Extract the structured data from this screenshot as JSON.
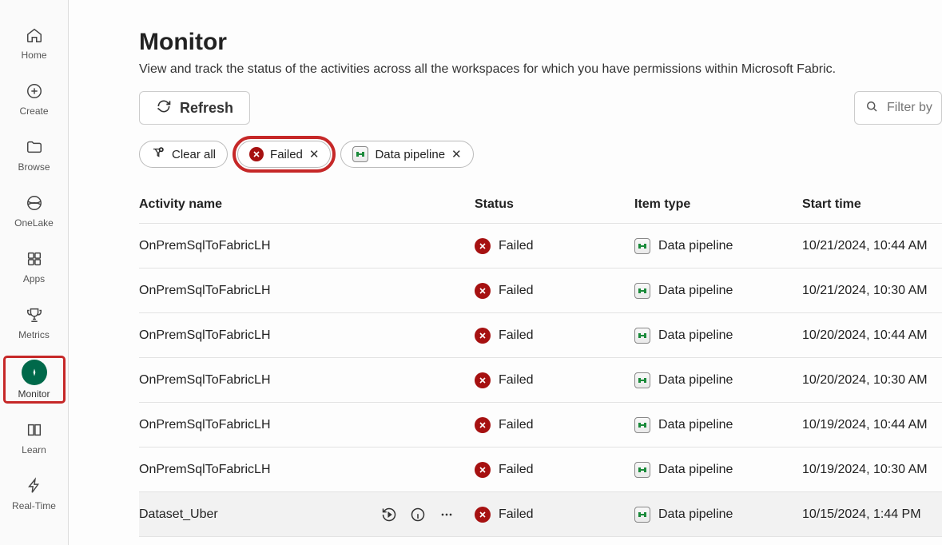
{
  "sidebar": {
    "items": [
      {
        "label": "Home"
      },
      {
        "label": "Create"
      },
      {
        "label": "Browse"
      },
      {
        "label": "OneLake"
      },
      {
        "label": "Apps"
      },
      {
        "label": "Metrics"
      },
      {
        "label": "Monitor"
      },
      {
        "label": "Learn"
      },
      {
        "label": "Real-Time"
      }
    ]
  },
  "page": {
    "title": "Monitor",
    "subtitle": "View and track the status of the activities across all the workspaces for which you have permissions within Microsoft Fabric."
  },
  "toolbar": {
    "refresh": "Refresh",
    "filter_placeholder": "Filter by"
  },
  "chips": {
    "clear_all": "Clear all",
    "failed": "Failed",
    "data_pipeline": "Data pipeline"
  },
  "table": {
    "headers": {
      "activity": "Activity name",
      "status": "Status",
      "type": "Item type",
      "start": "Start time"
    },
    "rows": [
      {
        "name": "OnPremSqlToFabricLH",
        "status": "Failed",
        "type": "Data pipeline",
        "start": "10/21/2024, 10:44 AM",
        "hover": false
      },
      {
        "name": "OnPremSqlToFabricLH",
        "status": "Failed",
        "type": "Data pipeline",
        "start": "10/21/2024, 10:30 AM",
        "hover": false
      },
      {
        "name": "OnPremSqlToFabricLH",
        "status": "Failed",
        "type": "Data pipeline",
        "start": "10/20/2024, 10:44 AM",
        "hover": false
      },
      {
        "name": "OnPremSqlToFabricLH",
        "status": "Failed",
        "type": "Data pipeline",
        "start": "10/20/2024, 10:30 AM",
        "hover": false
      },
      {
        "name": "OnPremSqlToFabricLH",
        "status": "Failed",
        "type": "Data pipeline",
        "start": "10/19/2024, 10:44 AM",
        "hover": false
      },
      {
        "name": "OnPremSqlToFabricLH",
        "status": "Failed",
        "type": "Data pipeline",
        "start": "10/19/2024, 10:30 AM",
        "hover": false
      },
      {
        "name": "Dataset_Uber",
        "status": "Failed",
        "type": "Data pipeline",
        "start": "10/15/2024, 1:44 PM",
        "hover": true
      }
    ]
  },
  "colors": {
    "accent_red": "#c62828",
    "status_red": "#a61111",
    "brand_green": "#00694a",
    "pipeline_green": "#1a8a3a"
  }
}
